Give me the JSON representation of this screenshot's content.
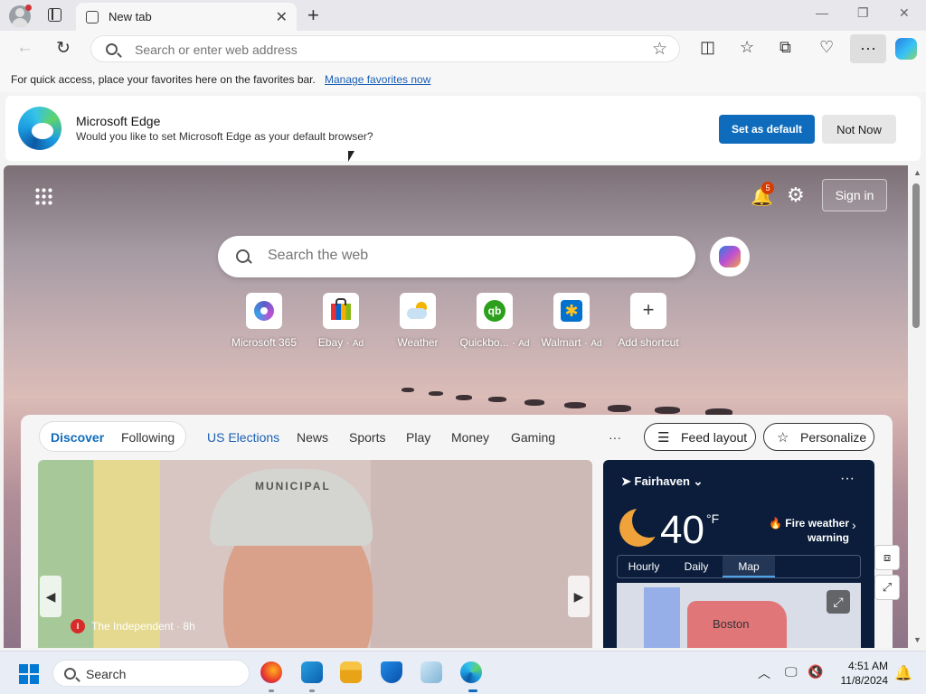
{
  "browser": {
    "tab_title": "New tab",
    "address_placeholder": "Search or enter web address"
  },
  "favbar": {
    "text": "For quick access, place your favorites here on the favorites bar.",
    "link": "Manage favorites now"
  },
  "banner": {
    "title": "Microsoft Edge",
    "subtitle": "Would you like to set Microsoft Edge as your default browser?",
    "primary_button": "Set as default",
    "secondary_button": "Not Now"
  },
  "ntp": {
    "notification_count": "5",
    "signin_label": "Sign in",
    "search_placeholder": "Search the web",
    "shortcuts": [
      {
        "label": "Microsoft 365",
        "ad": ""
      },
      {
        "label": "Ebay",
        "ad": "Ad"
      },
      {
        "label": "Weather",
        "ad": ""
      },
      {
        "label": "Quickbo...",
        "ad": "Ad"
      },
      {
        "label": "Walmart",
        "ad": "Ad"
      },
      {
        "label": "Add shortcut",
        "ad": ""
      }
    ]
  },
  "feed": {
    "tabs": [
      "Discover",
      "Following",
      "US Elections",
      "News",
      "Sports",
      "Play",
      "Money",
      "Gaming"
    ],
    "more": "···",
    "feed_layout_label": "Feed layout",
    "personalize_label": "Personalize",
    "hero": {
      "source": "The Independent · 8h",
      "source_logo": "I",
      "cap_text": "MUNICIPAL"
    }
  },
  "weather": {
    "location": "Fairhaven",
    "temperature": "40",
    "unit": "°F",
    "alert": "Fire weather warning",
    "tabs": [
      "Hourly",
      "Daily",
      "Map"
    ],
    "active_tab": "Map",
    "map_label": "Boston"
  },
  "taskbar": {
    "search_label": "Search",
    "time": "4:51 AM",
    "date": "11/8/2024"
  },
  "colors": {
    "accent": "#0f6cbd",
    "alert_red": "#e8483c"
  }
}
